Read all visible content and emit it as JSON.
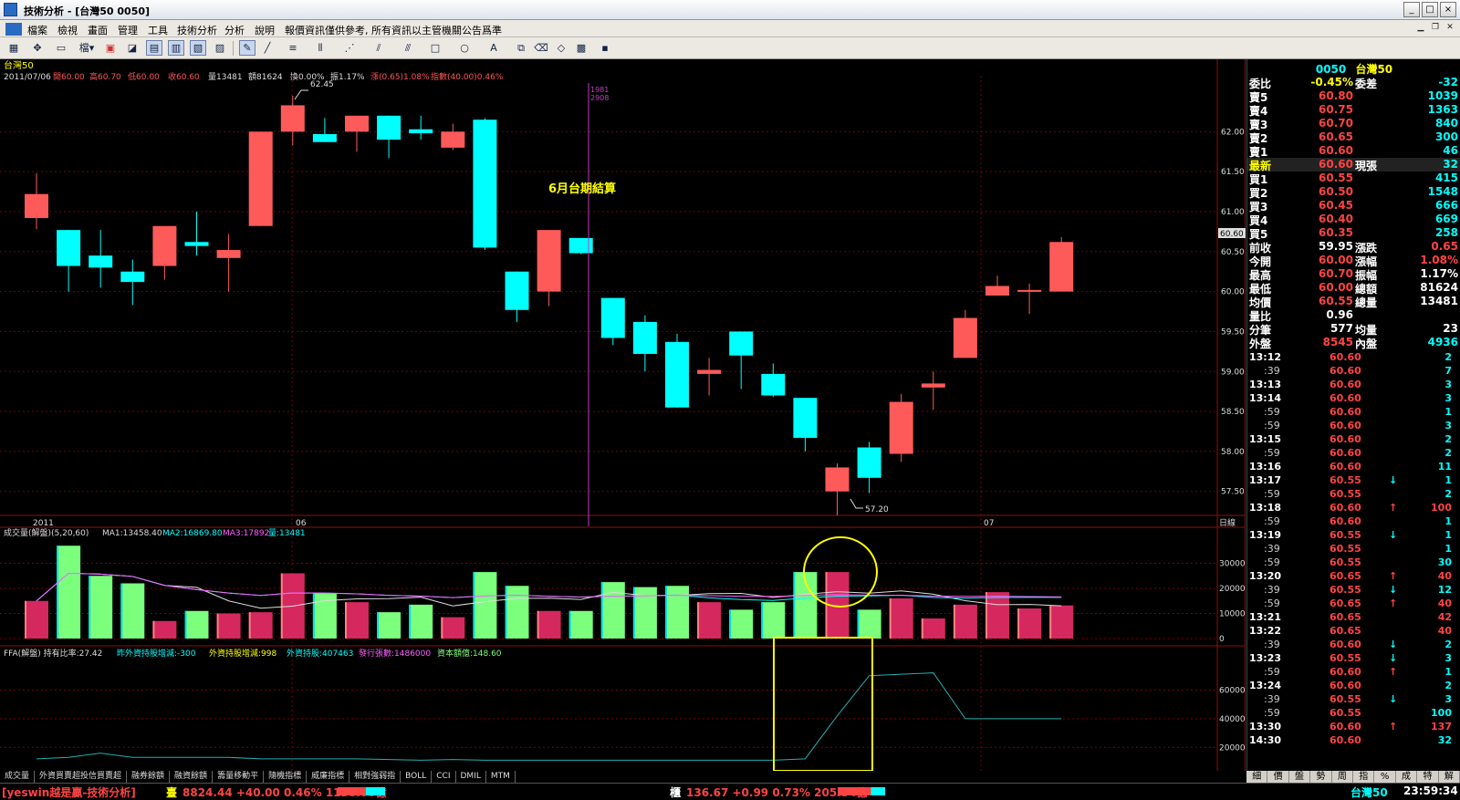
{
  "window": {
    "title": "技術分析 - [台灣50 0050]",
    "min": "_",
    "max": "□",
    "close": "×"
  },
  "menu": [
    "檔案",
    "檢視",
    "畫面",
    "管理",
    "工具",
    "技術分析",
    "分析",
    "說明",
    "報價資訊僅供參考, 所有資訊以主管機關公告爲準"
  ],
  "toolbar": {
    "period_label": "檔"
  },
  "colors": {
    "up": "#ff5a5a",
    "down": "#00ffff",
    "vol_up": "#d5285f",
    "vol_down": "#7cff7c",
    "accent_yellow": "#ffff00",
    "bg": "#000000"
  },
  "chart": {
    "stock_name": "台灣50",
    "info_date": "2011/07/06",
    "info_open": "開60.00",
    "info_high": "高60.70",
    "info_low": "低60.00",
    "info_close": "收60.60",
    "info_vol": "量13481",
    "info_amount": "額81624",
    "info_turn": "換0.00%",
    "info_amp": "振1.17%",
    "info_chg": "漲(0.65)1.08%",
    "info_index": "指數(40.00)0.46%",
    "high_label": "62.45",
    "low_label": "57.20",
    "cursor_top": "1981",
    "cursor_bot": "2908",
    "annotation": "6月台期結算",
    "price_tag": "60.60",
    "x_labels": [
      "2011",
      "06",
      "07"
    ],
    "x_unit": "日線",
    "price_ticks": [
      "62.00",
      "61.50",
      "61.00",
      "60.50",
      "60.00",
      "59.50",
      "59.00",
      "58.50",
      "58.00",
      "57.50"
    ],
    "vol_title": "成交量(解盤)(5,20,60)",
    "vol_ma1": "MA1:13458.40",
    "vol_ma2": "MA2:16869.80",
    "vol_ma3": "MA3:17892",
    "vol_now": "量:13481",
    "vol_ticks": [
      "30000",
      "20000",
      "10000",
      "0"
    ],
    "ffa_title": "FFA(解盤) 持有比率:27.42",
    "ffa_chg": "昨外資持股增減:-300",
    "ffa_chg2": "外資持股增減:998",
    "ffa_hold": "外資持股:407463",
    "ffa_issue": "發行張數:1486000",
    "ffa_cap": "資本額億:148.60",
    "ffa_ticks": [
      "600000",
      "400000",
      "200000"
    ]
  },
  "chart_data": {
    "type": "candlestick",
    "title": "台灣50",
    "ylim": [
      57.2,
      62.7
    ],
    "candles": [
      {
        "o": 60.92,
        "h": 61.48,
        "l": 60.78,
        "c": 61.22
      },
      {
        "o": 60.77,
        "h": 60.77,
        "l": 60.0,
        "c": 60.32
      },
      {
        "o": 60.45,
        "h": 60.77,
        "l": 60.05,
        "c": 60.3
      },
      {
        "o": 60.25,
        "h": 60.4,
        "l": 59.83,
        "c": 60.12
      },
      {
        "o": 60.32,
        "h": 60.45,
        "l": 60.15,
        "c": 60.82
      },
      {
        "o": 60.62,
        "h": 61.0,
        "l": 60.45,
        "c": 60.57
      },
      {
        "o": 60.42,
        "h": 60.72,
        "l": 60.0,
        "c": 60.52
      },
      {
        "o": 60.82,
        "h": 61.0,
        "l": 60.82,
        "c": 62.0
      },
      {
        "o": 62.0,
        "h": 62.45,
        "l": 61.83,
        "c": 62.33
      },
      {
        "o": 61.97,
        "h": 62.17,
        "l": 61.87,
        "c": 61.87
      },
      {
        "o": 62.0,
        "h": 62.2,
        "l": 61.75,
        "c": 62.2
      },
      {
        "o": 62.2,
        "h": 62.2,
        "l": 61.67,
        "c": 61.9
      },
      {
        "o": 62.03,
        "h": 62.2,
        "l": 61.9,
        "c": 61.98
      },
      {
        "o": 61.8,
        "h": 62.1,
        "l": 61.77,
        "c": 62.0
      },
      {
        "o": 62.15,
        "h": 62.17,
        "l": 60.52,
        "c": 60.55
      },
      {
        "o": 60.25,
        "h": 60.25,
        "l": 59.62,
        "c": 59.77
      },
      {
        "o": 60.0,
        "h": 60.77,
        "l": 59.82,
        "c": 60.77
      },
      {
        "o": 60.67,
        "h": 60.67,
        "l": 60.47,
        "c": 60.48
      },
      {
        "o": 59.92,
        "h": 59.92,
        "l": 59.33,
        "c": 59.42
      },
      {
        "o": 59.62,
        "h": 59.7,
        "l": 59.0,
        "c": 59.22
      },
      {
        "o": 59.37,
        "h": 59.47,
        "l": 58.55,
        "c": 58.55
      },
      {
        "o": 58.97,
        "h": 59.17,
        "l": 58.7,
        "c": 59.02
      },
      {
        "o": 59.5,
        "h": 59.5,
        "l": 58.78,
        "c": 59.2
      },
      {
        "o": 58.97,
        "h": 59.1,
        "l": 58.68,
        "c": 58.7
      },
      {
        "o": 58.67,
        "h": 58.67,
        "l": 58.0,
        "c": 58.17
      },
      {
        "o": 57.5,
        "h": 57.85,
        "l": 57.2,
        "c": 57.8
      },
      {
        "o": 58.05,
        "h": 58.12,
        "l": 57.48,
        "c": 57.67
      },
      {
        "o": 57.97,
        "h": 58.72,
        "l": 57.87,
        "c": 58.62
      },
      {
        "o": 58.8,
        "h": 59.0,
        "l": 58.52,
        "c": 58.85
      },
      {
        "o": 59.17,
        "h": 59.77,
        "l": 59.17,
        "c": 59.67
      },
      {
        "o": 59.95,
        "h": 60.2,
        "l": 59.95,
        "c": 60.07
      },
      {
        "o": 60.0,
        "h": 60.1,
        "l": 59.72,
        "c": 60.02
      },
      {
        "o": 60.0,
        "h": 60.68,
        "l": 60.0,
        "c": 60.62
      }
    ],
    "volume": [
      15000,
      37000,
      25000,
      22000,
      7000,
      11000,
      10000,
      10500,
      26000,
      18000,
      14500,
      10500,
      13500,
      8500,
      26500,
      21000,
      11000,
      11000,
      22500,
      20500,
      21000,
      14500,
      11500,
      14500,
      26500,
      26500,
      11500,
      16000,
      8000,
      13500,
      18500,
      12000,
      13200
    ],
    "volume_ylim": [
      0,
      40000
    ],
    "ffa_ylim": [
      100000,
      800000
    ],
    "ffa_start_index": 24,
    "ffa": [
      120000,
      130000,
      160000,
      130000,
      130000,
      130000,
      130000,
      120000,
      120000,
      120000,
      120000,
      115000,
      110000,
      115000,
      110000,
      110000,
      110000,
      110000,
      110000,
      110000,
      110000,
      110000,
      110000,
      110000,
      120000,
      420000,
      700000,
      710000,
      720000,
      400000,
      400000,
      400000,
      400000
    ]
  },
  "quote": {
    "code": "0050",
    "name": "台灣50",
    "rows": [
      {
        "l1": "委比",
        "v1": "-0.45%",
        "c1": "#ff0",
        "l2": "委差",
        "v2": "-32",
        "c2": "#0ff"
      },
      {
        "l1": "賣5",
        "v1": "60.80",
        "c1": "#f44",
        "l2": "",
        "v2": "1039",
        "c2": "#0ff"
      },
      {
        "l1": "賣4",
        "v1": "60.75",
        "c1": "#f44",
        "l2": "",
        "v2": "1363",
        "c2": "#0ff"
      },
      {
        "l1": "賣3",
        "v1": "60.70",
        "c1": "#f44",
        "l2": "",
        "v2": "840",
        "c2": "#0ff"
      },
      {
        "l1": "賣2",
        "v1": "60.65",
        "c1": "#f44",
        "l2": "",
        "v2": "300",
        "c2": "#0ff"
      },
      {
        "l1": "賣1",
        "v1": "60.60",
        "c1": "#f44",
        "l2": "",
        "v2": "46",
        "c2": "#0ff"
      },
      {
        "l1": "最新",
        "v1": "60.60",
        "c1": "#f44",
        "l2": "現張",
        "v2": "32",
        "c2": "#0ff",
        "hl": "#ff0"
      },
      {
        "l1": "買1",
        "v1": "60.55",
        "c1": "#f44",
        "l2": "",
        "v2": "415",
        "c2": "#0ff"
      },
      {
        "l1": "買2",
        "v1": "60.50",
        "c1": "#f44",
        "l2": "",
        "v2": "1548",
        "c2": "#0ff"
      },
      {
        "l1": "買3",
        "v1": "60.45",
        "c1": "#f44",
        "l2": "",
        "v2": "666",
        "c2": "#0ff"
      },
      {
        "l1": "買4",
        "v1": "60.40",
        "c1": "#f44",
        "l2": "",
        "v2": "669",
        "c2": "#0ff"
      },
      {
        "l1": "買5",
        "v1": "60.35",
        "c1": "#f44",
        "l2": "",
        "v2": "258",
        "c2": "#0ff"
      },
      {
        "l1": "前收",
        "v1": "59.95",
        "c1": "#fff",
        "l2": "漲跌",
        "v2": "0.65",
        "c2": "#f44"
      },
      {
        "l1": "今開",
        "v1": "60.00",
        "c1": "#f44",
        "l2": "漲幅",
        "v2": "1.08%",
        "c2": "#f44"
      },
      {
        "l1": "最高",
        "v1": "60.70",
        "c1": "#f44",
        "l2": "振幅",
        "v2": "1.17%",
        "c2": "#fff"
      },
      {
        "l1": "最低",
        "v1": "60.00",
        "c1": "#f44",
        "l2": "總額",
        "v2": "81624",
        "c2": "#fff"
      },
      {
        "l1": "均價",
        "v1": "60.55",
        "c1": "#f44",
        "l2": "總量",
        "v2": "13481",
        "c2": "#fff"
      },
      {
        "l1": "量比",
        "v1": "0.96",
        "c1": "#fff",
        "l2": "",
        "v2": "",
        "c2": "#fff"
      },
      {
        "l1": "分筆",
        "v1": "577",
        "c1": "#fff",
        "l2": "均量",
        "v2": "23",
        "c2": "#fff"
      },
      {
        "l1": "外盤",
        "v1": "8545",
        "c1": "#f44",
        "l2": "內盤",
        "v2": "4936",
        "c2": "#0ff"
      }
    ],
    "ticks": [
      {
        "t": "13:12",
        "p": "60.60",
        "a": "",
        "v": "2",
        "vc": "#0ff"
      },
      {
        "t": ":39",
        "p": "60.60",
        "a": "",
        "v": "7",
        "vc": "#0ff"
      },
      {
        "t": "13:13",
        "p": "60.60",
        "a": "",
        "v": "3",
        "vc": "#0ff"
      },
      {
        "t": "13:14",
        "p": "60.60",
        "a": "",
        "v": "3",
        "vc": "#0ff"
      },
      {
        "t": ":59",
        "p": "60.60",
        "a": "",
        "v": "1",
        "vc": "#0ff"
      },
      {
        "t": ":59",
        "p": "60.60",
        "a": "",
        "v": "3",
        "vc": "#0ff"
      },
      {
        "t": "13:15",
        "p": "60.60",
        "a": "",
        "v": "2",
        "vc": "#0ff"
      },
      {
        "t": ":59",
        "p": "60.60",
        "a": "",
        "v": "2",
        "vc": "#0ff"
      },
      {
        "t": "13:16",
        "p": "60.60",
        "a": "",
        "v": "11",
        "vc": "#0ff"
      },
      {
        "t": "13:17",
        "p": "60.55",
        "a": "↓",
        "ac": "#0ff",
        "v": "1",
        "vc": "#0ff"
      },
      {
        "t": ":59",
        "p": "60.55",
        "a": "",
        "v": "2",
        "vc": "#0ff"
      },
      {
        "t": "13:18",
        "p": "60.60",
        "a": "↑",
        "ac": "#f44",
        "v": "100",
        "vc": "#f44"
      },
      {
        "t": ":59",
        "p": "60.60",
        "a": "",
        "v": "1",
        "vc": "#0ff"
      },
      {
        "t": "13:19",
        "p": "60.55",
        "a": "↓",
        "ac": "#0ff",
        "v": "1",
        "vc": "#0ff"
      },
      {
        "t": ":39",
        "p": "60.55",
        "a": "",
        "v": "1",
        "vc": "#0ff"
      },
      {
        "t": ":59",
        "p": "60.55",
        "a": "",
        "v": "30",
        "vc": "#0ff"
      },
      {
        "t": "13:20",
        "p": "60.65",
        "a": "↑",
        "ac": "#f44",
        "v": "40",
        "vc": "#f44"
      },
      {
        "t": ":39",
        "p": "60.55",
        "a": "↓",
        "ac": "#0ff",
        "v": "12",
        "vc": "#0ff"
      },
      {
        "t": ":59",
        "p": "60.65",
        "a": "↑",
        "ac": "#f44",
        "v": "40",
        "vc": "#f44"
      },
      {
        "t": "13:21",
        "p": "60.65",
        "a": "",
        "v": "42",
        "vc": "#f44"
      },
      {
        "t": "13:22",
        "p": "60.65",
        "a": "",
        "v": "40",
        "vc": "#f44"
      },
      {
        "t": ":39",
        "p": "60.60",
        "a": "↓",
        "ac": "#0ff",
        "v": "2",
        "vc": "#0ff"
      },
      {
        "t": "13:23",
        "p": "60.55",
        "a": "↓",
        "ac": "#0ff",
        "v": "3",
        "vc": "#0ff"
      },
      {
        "t": ":59",
        "p": "60.60",
        "a": "↑",
        "ac": "#f44",
        "v": "1",
        "vc": "#0ff"
      },
      {
        "t": "13:24",
        "p": "60.60",
        "a": "",
        "v": "2",
        "vc": "#0ff"
      },
      {
        "t": ":39",
        "p": "60.55",
        "a": "↓",
        "ac": "#0ff",
        "v": "3",
        "vc": "#0ff"
      },
      {
        "t": ":59",
        "p": "60.55",
        "a": "",
        "v": "100",
        "vc": "#0ff"
      },
      {
        "t": "13:30",
        "p": "60.60",
        "a": "↑",
        "ac": "#f44",
        "v": "137",
        "vc": "#f44"
      },
      {
        "t": "14:30",
        "p": "60.60",
        "a": "",
        "v": "32",
        "vc": "#0ff"
      }
    ]
  },
  "bottom_tabs": [
    "成交量",
    "外資買賣超投信買賣超",
    "融券餘額",
    "融資餘額",
    "籌量移動平",
    "隨機指標",
    "威廉指標",
    "相對強弱指",
    "BOLL",
    "CCI",
    "DMIL",
    "MTM"
  ],
  "right_tabs": [
    "細",
    "價",
    "盤",
    "勢",
    "周",
    "指",
    "%",
    "成",
    "特",
    "解"
  ],
  "status": {
    "app": "[yeswin越是贏-技術分析]",
    "idx1_label": "臺",
    "idx1": "8824.44 +40.00 0.46% 1130.60億",
    "idx2_label": "櫃",
    "idx2": "136.67 +0.99 0.73% 205.54億",
    "stock": "台灣50",
    "time": "23:59:34"
  }
}
